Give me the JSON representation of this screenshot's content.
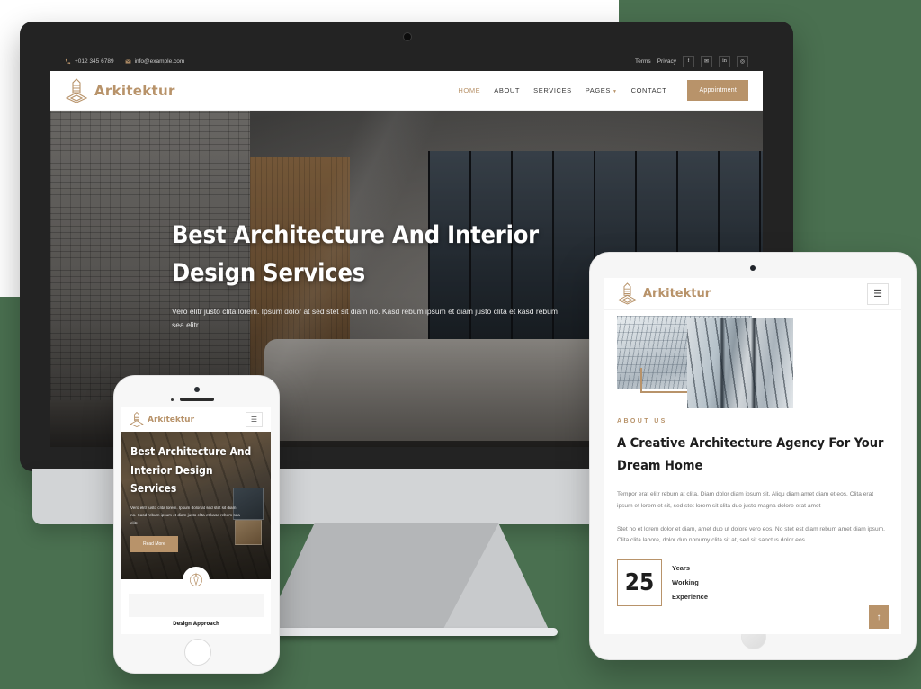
{
  "theme": {
    "accent": "#b8936a",
    "background": "#4a7050",
    "dark": "#232323",
    "card": "#ffffff"
  },
  "desktop": {
    "topbar": {
      "phone": "+012 345 6789",
      "phone_icon": "phone-icon",
      "email": "info@example.com",
      "email_icon": "envelope-icon",
      "links": [
        "Terms",
        "Privacy"
      ],
      "social": [
        {
          "name": "facebook-icon",
          "glyph": "f"
        },
        {
          "name": "twitter-icon",
          "glyph": "✉"
        },
        {
          "name": "linkedin-icon",
          "glyph": "in"
        },
        {
          "name": "instagram-icon",
          "glyph": "◎"
        }
      ]
    },
    "brand": "Arkitektur",
    "brand_icon": "tower-logo-icon",
    "nav": [
      {
        "label": "HOME",
        "active": true,
        "caret": false
      },
      {
        "label": "ABOUT",
        "active": false,
        "caret": false
      },
      {
        "label": "SERVICES",
        "active": false,
        "caret": false
      },
      {
        "label": "PAGES",
        "active": false,
        "caret": true
      },
      {
        "label": "CONTACT",
        "active": false,
        "caret": false
      }
    ],
    "cta": "Appointment",
    "hero": {
      "heading": "Best Architecture And Interior Design Services",
      "paragraph": "Vero elitr justo clita lorem. Ipsum dolor at sed stet sit diam no. Kasd rebum ipsum et diam justo clita et kasd rebum sea elitr.",
      "image": "modern-living-room-interior-photo"
    }
  },
  "tablet": {
    "brand": "Arkitektur",
    "brand_icon": "tower-logo-icon",
    "menu_icon": "hamburger-menu-icon",
    "images": [
      {
        "name": "bridge-architecture-photo"
      },
      {
        "name": "glass-skyscraper-photo"
      }
    ],
    "eyebrow": "ABOUT US",
    "heading": "A Creative Architecture Agency For Your Dream Home",
    "paragraph1": "Tempor erat elitr rebum at clita. Diam dolor diam ipsum sit. Aliqu diam amet diam et eos. Clita erat ipsum et lorem et sit, sed stet lorem sit clita duo justo magna dolore erat amet",
    "paragraph2": "Stet no et lorem dolor et diam, amet duo ut dolore vero eos. No stet est diam rebum amet diam ipsum. Clita clita labore, dolor duo nonumy clita sit at, sed sit sanctus dolor eos.",
    "stat_number": "25",
    "stat_lines": [
      "Years",
      "Working",
      "Experience"
    ],
    "back_to_top_icon": "arrow-up-icon"
  },
  "phone": {
    "brand": "Arkitektur",
    "brand_icon": "tower-logo-icon",
    "menu_icon": "hamburger-menu-icon",
    "heading": "Best Architecture And Interior Design Services",
    "paragraph": "Vero elitr justo clita lorem. Ipsum dolor at sed stet sit diam no. Kasd rebum ipsum et diam justo clita et kasd rebum sea elitr.",
    "cta": "Read More",
    "section_icon": "compass-badge-icon",
    "section_caption": "Design Approach"
  }
}
